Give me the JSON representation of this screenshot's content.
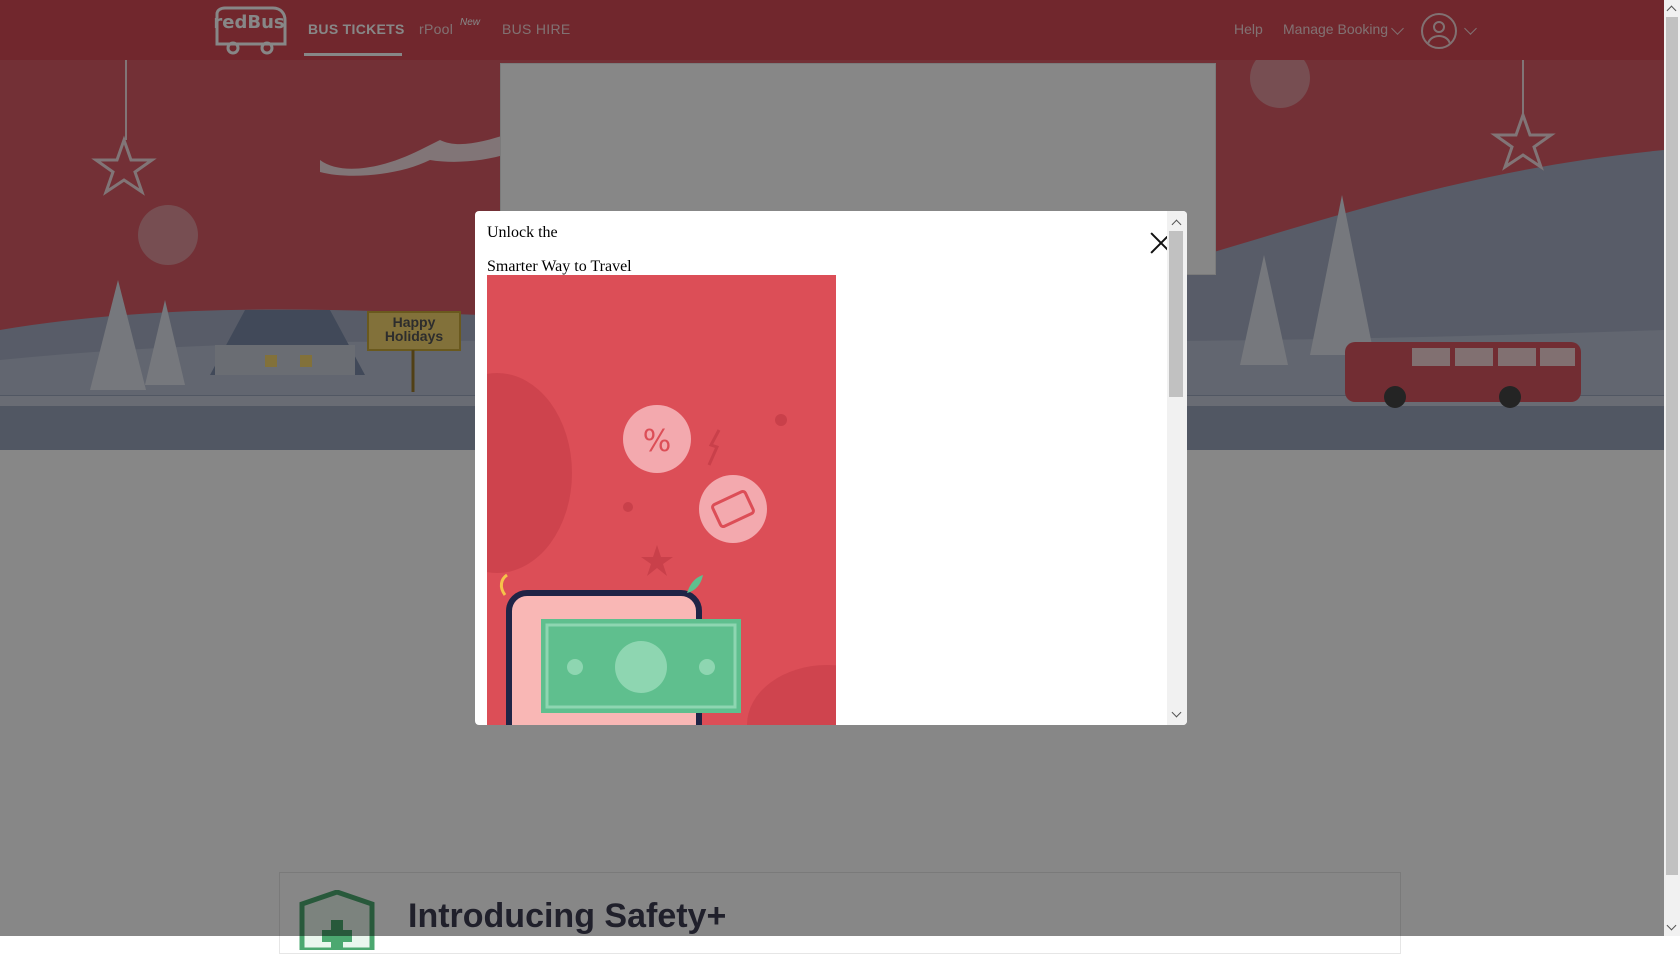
{
  "header": {
    "logo_text": "redBus",
    "nav": [
      {
        "label": "BUS TICKETS",
        "active": true
      },
      {
        "label": "rPool",
        "tag": "New"
      },
      {
        "label": "BUS HIRE"
      }
    ],
    "help_label": "Help",
    "manage_booking_label": "Manage Booking"
  },
  "hero": {
    "sign_line1": "Happy",
    "sign_line2": "Holidays"
  },
  "safety": {
    "title": "Introducing Safety+"
  },
  "modal": {
    "title_line1": "Unlock the",
    "title_line2": "Smarter Way to Travel"
  },
  "colors": {
    "brand_red": "#d84f57",
    "promo_bg": "#dc4e57",
    "money_green": "#5fbf8e"
  },
  "icons": [
    "redbus-logo",
    "chevron-down-icon",
    "user-icon",
    "close-icon",
    "percent-badge-icon",
    "ticket-badge-icon",
    "shield-plus-icon"
  ]
}
